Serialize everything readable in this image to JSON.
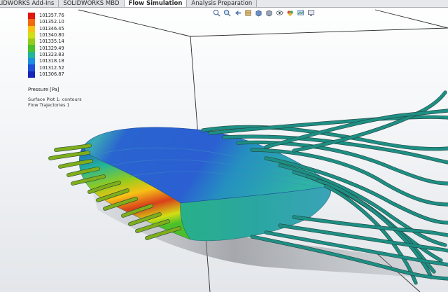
{
  "tabs": [
    {
      "label": "LIDWORKS Add-Ins",
      "active": false
    },
    {
      "label": "SOLIDWORKS MBD",
      "active": false
    },
    {
      "label": "Flow Simulation",
      "active": true
    },
    {
      "label": "Analysis Preparation",
      "active": false
    }
  ],
  "toolbar_icons": [
    "zoom-to-fit-icon",
    "zoom-area-icon",
    "previous-view-icon",
    "section-view-icon",
    "view-orientation-icon",
    "display-style-icon",
    "hide-show-icon",
    "edit-appearance-icon",
    "scene-icon",
    "view-settings-icon"
  ],
  "legend": {
    "values": [
      "101357.76",
      "101352.10",
      "101346.45",
      "101340.80",
      "101335.14",
      "101329.49",
      "101323.83",
      "101318.18",
      "101312.52",
      "101306.87"
    ],
    "colors": [
      "#e0160f",
      "#f26a11",
      "#f7c216",
      "#d3de14",
      "#93cc1d",
      "#4bc02a",
      "#22b59a",
      "#1c8fe0",
      "#1f4fd6",
      "#1526b8"
    ],
    "units": "Pressure [Pa]"
  },
  "plot_notes": {
    "line1": "Surface Plot 1: contours",
    "line2": "Flow Trajectories 1"
  },
  "colors": {
    "wing_blue": "#2f5fd0",
    "wing_teal": "#25a6a8",
    "streamline_teal": "#1d8f85",
    "streamline_green": "#7fae1a",
    "leading_edge_red": "#d8401a"
  }
}
